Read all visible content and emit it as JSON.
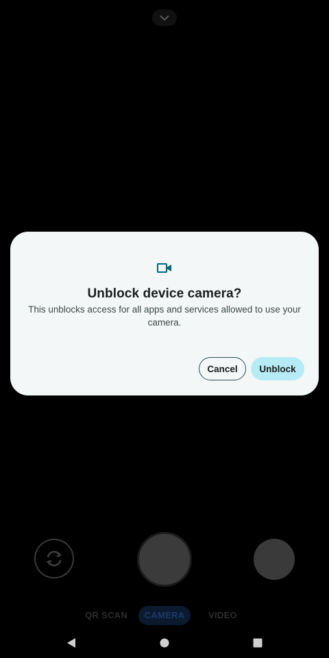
{
  "camera_ui": {
    "modes": {
      "qr_scan": "QR SCAN",
      "camera": "CAMERA",
      "video": "VIDEO"
    },
    "active_mode": "camera"
  },
  "dialog": {
    "icon": "videocam-icon",
    "title": "Unblock device camera?",
    "body": "This unblocks access for all apps and services allowed to use your camera.",
    "cancel_label": "Cancel",
    "unblock_label": "Unblock"
  },
  "colors": {
    "dialog_background": "#f4f7f7",
    "accent": "#006874",
    "primary_button": "#b6ebf6"
  }
}
